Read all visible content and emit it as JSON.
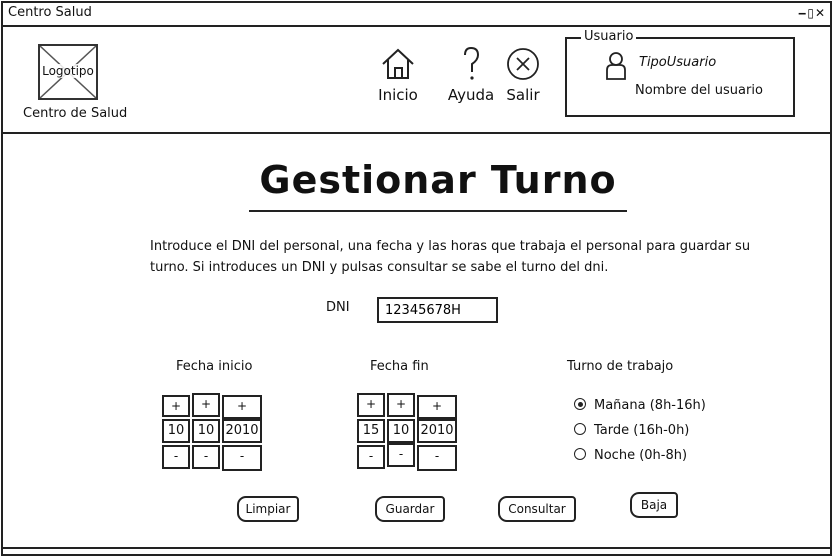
{
  "window": {
    "title": "Centro Salud",
    "controls": "‒▯✕"
  },
  "header": {
    "logo_label": "Logotipo",
    "logo_caption": "Centro de Salud",
    "nav": [
      {
        "id": "inicio",
        "label": "Inicio",
        "icon": "home-icon"
      },
      {
        "id": "ayuda",
        "label": "Ayuda",
        "icon": "help-icon"
      },
      {
        "id": "salir",
        "label": "Salir",
        "icon": "close-circle-icon"
      }
    ],
    "user": {
      "legend": "Usuario",
      "type": "TipoUsuario",
      "name": "Nombre del usuario"
    }
  },
  "main": {
    "title": "Gestionar Turno",
    "description": "Introduce el DNI del personal, una fecha y las horas que trabaja el personal para guardar su turno. Si introduces un DNI y pulsas consultar se sabe el turno del dni.",
    "dni": {
      "label": "DNI",
      "value": "12345678H"
    },
    "fecha_inicio": {
      "label": "Fecha inicio",
      "day": "10",
      "month": "10",
      "year": "2010"
    },
    "fecha_fin": {
      "label": "Fecha fin",
      "day": "15",
      "month": "10",
      "year": "2010"
    },
    "stepper": {
      "plus": "+",
      "minus": "-"
    },
    "turno": {
      "label": "Turno de trabajo",
      "options": [
        {
          "label": "Mañana (8h-16h)",
          "selected": true
        },
        {
          "label": "Tarde (16h-0h)",
          "selected": false
        },
        {
          "label": "Noche (0h-8h)",
          "selected": false
        }
      ]
    },
    "actions": {
      "limpiar": "Limpiar",
      "guardar": "Guardar",
      "consultar": "Consultar",
      "baja": "Baja"
    }
  }
}
